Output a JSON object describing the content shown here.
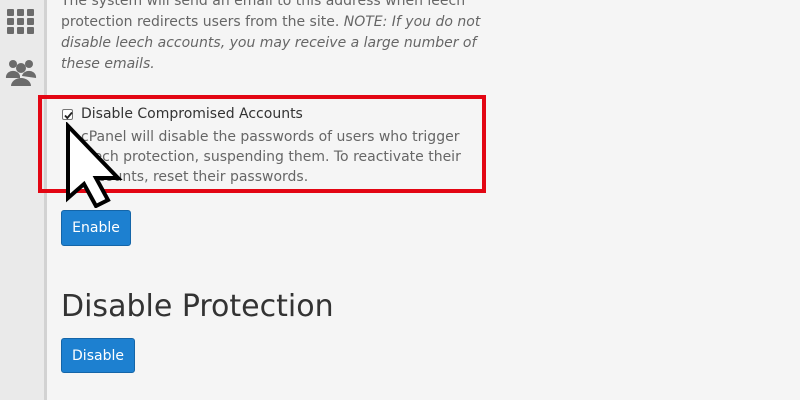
{
  "sidebar": {
    "icons": [
      "grid-icon",
      "users-icon"
    ]
  },
  "intro": {
    "line1": "The system will send an email to this address when leech",
    "line2": "protection redirects users from the site. ",
    "note": "NOTE: If you do not disable leech accounts, you may receive a large number of these emails."
  },
  "compromised": {
    "label": "Disable Compromised Accounts",
    "checked": true,
    "description": "cPanel will disable the passwords of users who trigger leech protection, suspending them. To reactivate their accounts, reset their passwords."
  },
  "buttons": {
    "enable": "Enable",
    "disable": "Disable"
  },
  "disable_section": {
    "title": "Disable Protection"
  },
  "colors": {
    "highlight": "#e30613",
    "button": "#1d80d0"
  }
}
